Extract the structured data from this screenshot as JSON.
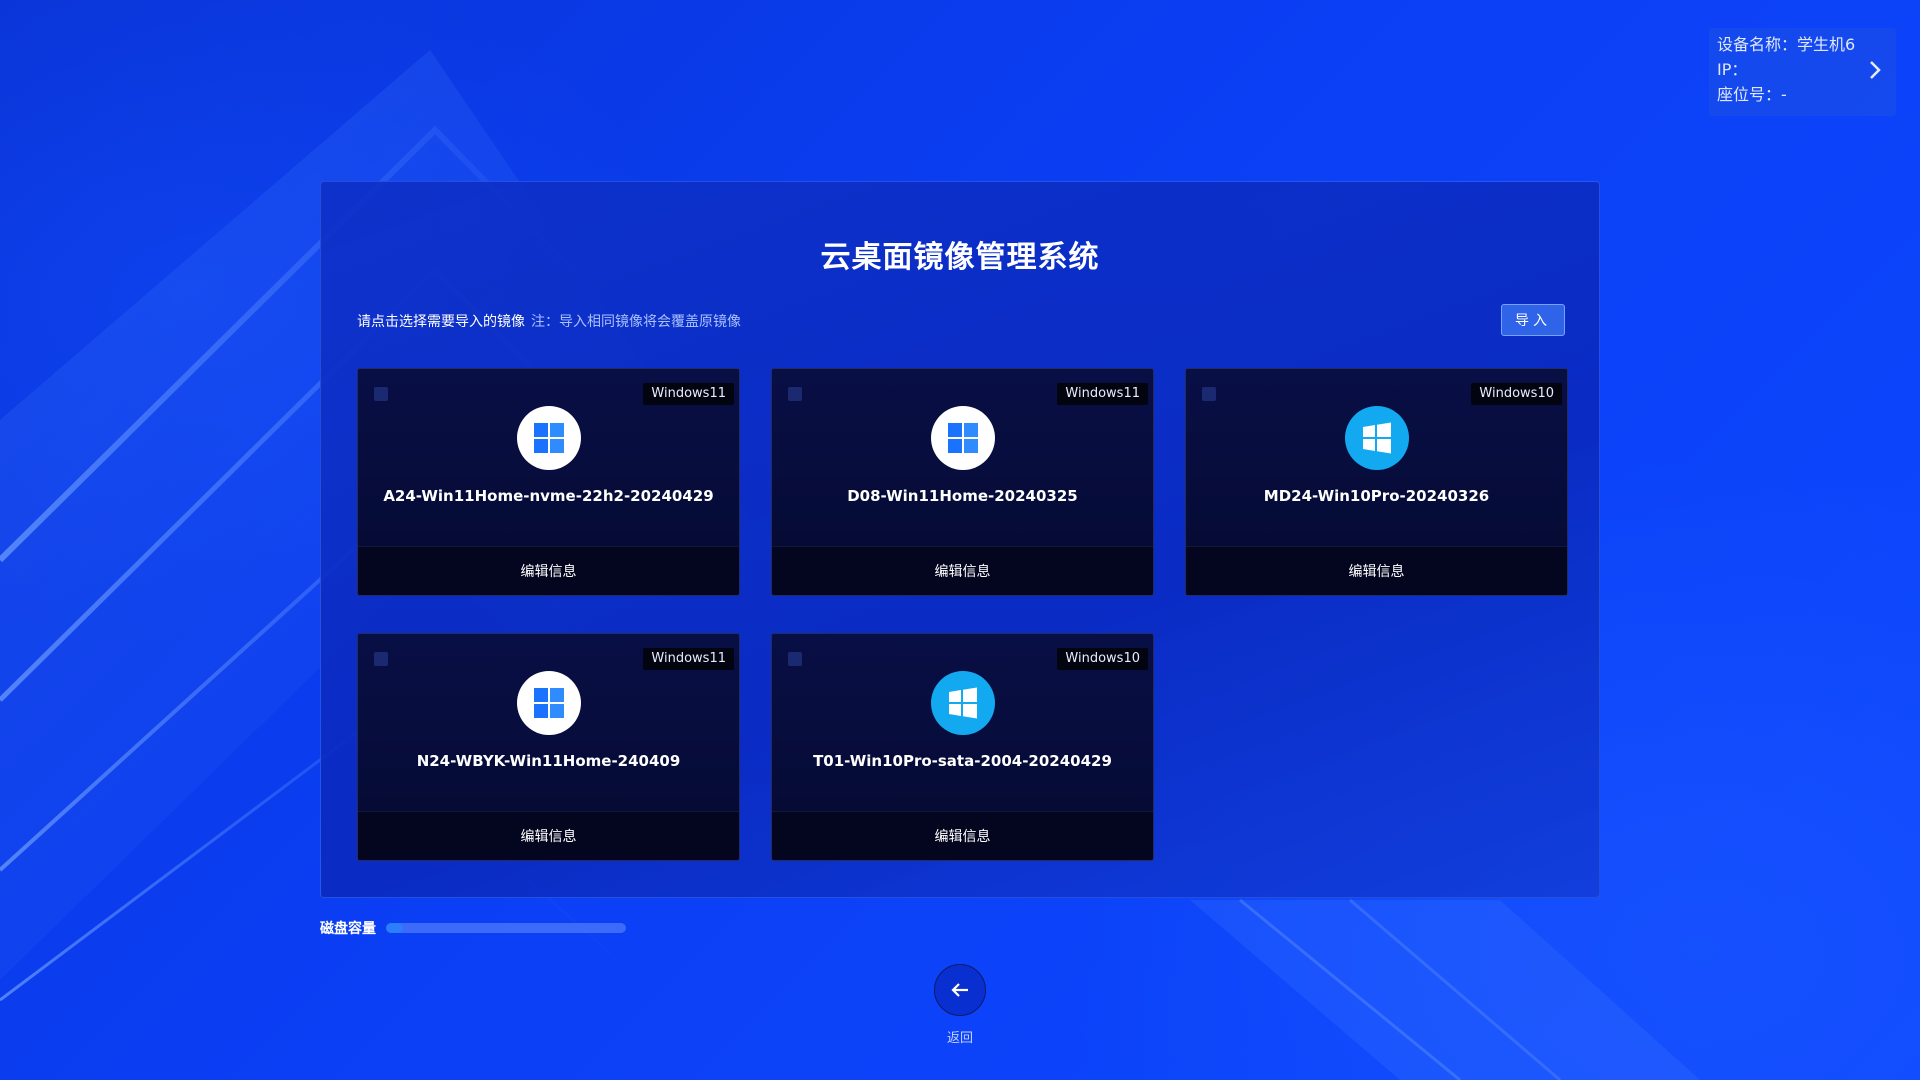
{
  "device": {
    "name_line": "设备名称：学生机6",
    "ip_line": "IP：",
    "seat_line": "座位号：-"
  },
  "main": {
    "title": "云桌面镜像管理系统",
    "hint": "请点击选择需要导入的镜像",
    "note": "注：导入相同镜像将会覆盖原镜像",
    "import_label": "导入"
  },
  "images": [
    {
      "name": "A24-Win11Home-nvme-22h2-20240429",
      "os": "Windows11",
      "icon": "windows11-logo-icon",
      "edit_label": "编辑信息"
    },
    {
      "name": "D08-Win11Home-20240325",
      "os": "Windows11",
      "icon": "windows11-logo-icon",
      "edit_label": "编辑信息"
    },
    {
      "name": "MD24-Win10Pro-20240326",
      "os": "Windows10",
      "icon": "windows10-logo-icon",
      "edit_label": "编辑信息"
    },
    {
      "name": "N24-WBYK-Win11Home-240409",
      "os": "Windows11",
      "icon": "windows11-logo-icon",
      "edit_label": "编辑信息"
    },
    {
      "name": "T01-Win10Pro-sata-2004-20240429",
      "os": "Windows10",
      "icon": "windows10-logo-icon",
      "edit_label": "编辑信息"
    }
  ],
  "disk": {
    "label": "磁盘容量",
    "used_fraction": 0.07
  },
  "footer": {
    "back_label": "返回"
  },
  "colors": {
    "accent": "#2f63e8",
    "win11_blue": "#1a73ff",
    "win10_cyan": "#12a9f0"
  }
}
